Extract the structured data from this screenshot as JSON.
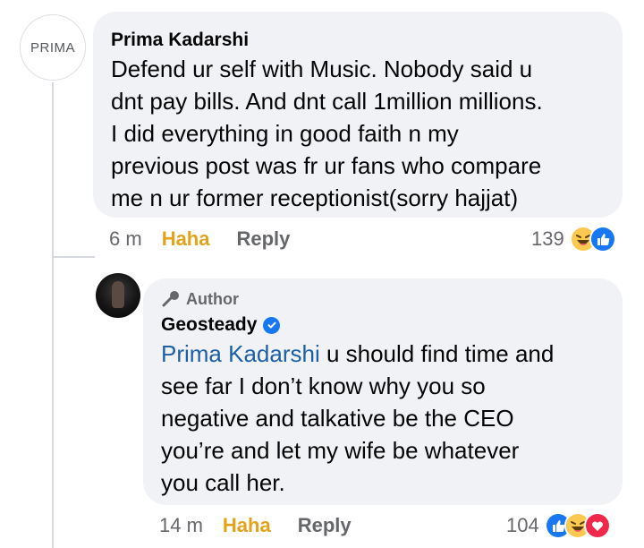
{
  "comment": {
    "avatar_text": "PRIMA",
    "author": "Prima Kadarshi",
    "lines": [
      "Defend ur self with Music. Nobody said u",
      "dnt pay bills. And dnt call 1million millions.",
      "I did everything in good faith n my",
      "previous post was fr ur fans who compare",
      "me n ur former receptionist(sorry hajjat)"
    ],
    "time": "6 m",
    "reaction_label": "Haha",
    "reply_label": "Reply",
    "reaction_count": "139",
    "reaction_icons": [
      "haha-icon",
      "like-icon"
    ]
  },
  "reply": {
    "badge": "Author",
    "author": "Geosteady",
    "verified": true,
    "mention": "Prima Kadarshi",
    "first_line_rest": " u should find time and",
    "lines": [
      "see far I don’t know why you so",
      "negative and talkative be the CEO",
      "you’re and let my wife be whatever",
      "you call her."
    ],
    "time": "14 m",
    "reaction_label": "Haha",
    "reply_label": "Reply",
    "reaction_count": "104",
    "reaction_icons": [
      "like-icon",
      "haha-icon",
      "love-icon"
    ]
  },
  "colors": {
    "bubble": "#f0f2f5",
    "haha": "#e2a31a",
    "mention": "#1d5fa6",
    "verified": "#1877f2",
    "meta": "#65676b"
  }
}
